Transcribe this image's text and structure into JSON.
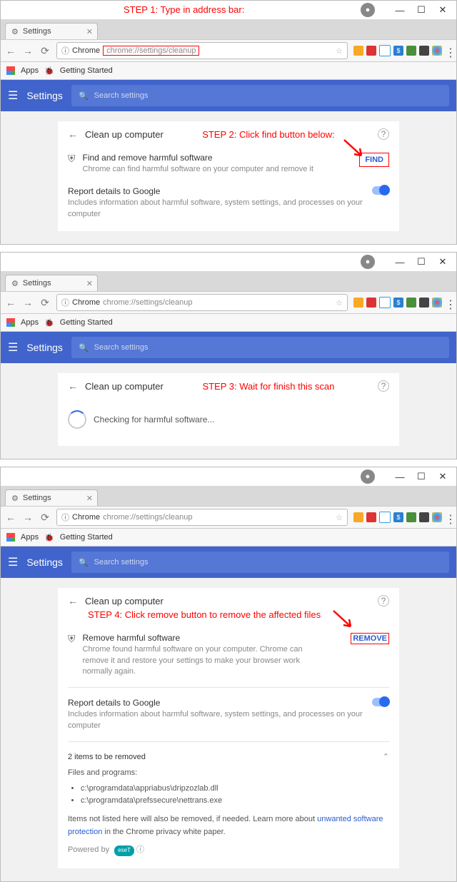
{
  "annotations": {
    "step1": "STEP 1: Type in address bar:",
    "step2": "STEP 2: Click find button below:",
    "step3": "STEP 3: Wait for finish this scan",
    "step4": "STEP 4: Click remove button to remove the affected files"
  },
  "window": {
    "tab_title": "Settings",
    "address_label": "Chrome",
    "url": "chrome://settings/cleanup",
    "bookmarks": {
      "apps": "Apps",
      "getting_started": "Getting Started"
    }
  },
  "settings": {
    "header": "Settings",
    "search_placeholder": "Search settings",
    "page_title": "Clean up computer"
  },
  "panel1": {
    "row_title": "Find and remove harmful software",
    "row_desc": "Chrome can find harmful software on your computer and remove it",
    "find_btn": "FIND",
    "report_title": "Report details to Google",
    "report_desc": "Includes information about harmful software, system settings, and processes on your computer"
  },
  "panel2": {
    "checking": "Checking for harmful software..."
  },
  "panel3": {
    "row_title": "Remove harmful software",
    "row_desc": "Chrome found harmful software on your computer. Chrome can remove it and restore your settings to make your browser work normally again.",
    "remove_btn": "REMOVE",
    "report_title": "Report details to Google",
    "report_desc": "Includes information about harmful software, system settings, and processes on your computer",
    "items_count": "2 items to be removed",
    "files_label": "Files and programs:",
    "files": [
      "c:\\programdata\\appriabus\\dripzozlab.dll",
      "c:\\programdata\\prefssecure\\nettrans.exe"
    ],
    "footnote1": "Items not listed here will also be removed, if needed. Learn more about ",
    "footnote_link": "unwanted software protection",
    "footnote2": " in the Chrome privacy white paper.",
    "powered": "Powered by"
  }
}
